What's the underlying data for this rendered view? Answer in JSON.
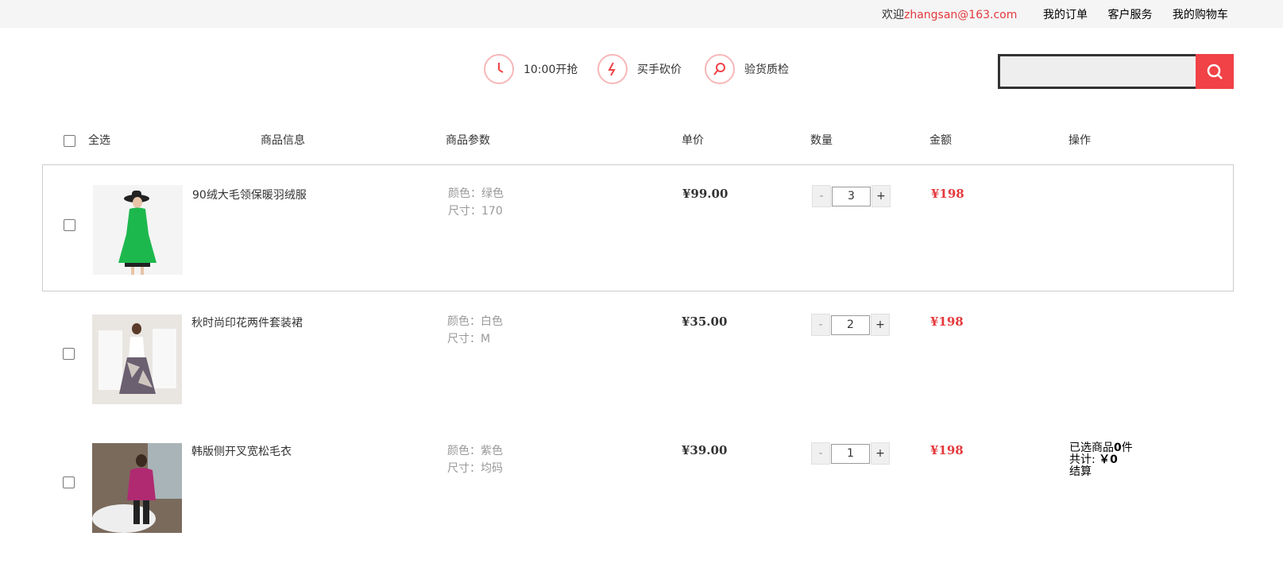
{
  "topbar": {
    "welcome_prefix": "欢迎",
    "email": "zhangsan@163.com",
    "links": [
      "我的订单",
      "客户服务",
      "我的购物车"
    ]
  },
  "features": [
    {
      "icon": "clock-icon",
      "label": "10:00开抢"
    },
    {
      "icon": "lightning-icon",
      "label": "买手砍价"
    },
    {
      "icon": "magnifier-icon",
      "label": "验货质检"
    }
  ],
  "search": {
    "value": "",
    "icon": "search-icon"
  },
  "table_header": {
    "select_all": "全选",
    "columns": [
      "商品信息",
      "商品参数",
      "单价",
      "数量",
      "金额",
      "操作"
    ]
  },
  "items": [
    {
      "name": "90绒大毛领保暖羽绒服",
      "color": "颜色：绿色",
      "size": "尺寸：170",
      "price": "¥99.00",
      "qty": "3",
      "amount": "¥198",
      "thumb": "green-down-coat"
    },
    {
      "name": "秋时尚印花两件套装裙",
      "color": "颜色：白色",
      "size": "尺寸：M",
      "price": "¥35.00",
      "qty": "2",
      "amount": "¥198",
      "thumb": "printed-skirt-set"
    },
    {
      "name": "韩版侧开叉宽松毛衣",
      "color": "颜色：紫色",
      "size": "尺寸：均码",
      "price": "¥39.00",
      "qty": "1",
      "amount": "¥198",
      "thumb": "purple-sweater"
    }
  ],
  "qty_minus": "-",
  "qty_plus": "+",
  "summary": {
    "selected_prefix": "已选商品",
    "selected_count": "0",
    "selected_suffix": "件",
    "total_label": "共计: ",
    "total_value": "￥0",
    "checkout": "结算"
  },
  "colors": {
    "accent": "#e4393c",
    "search_button": "#f04247",
    "topbar_bg": "#f5f5f5"
  }
}
